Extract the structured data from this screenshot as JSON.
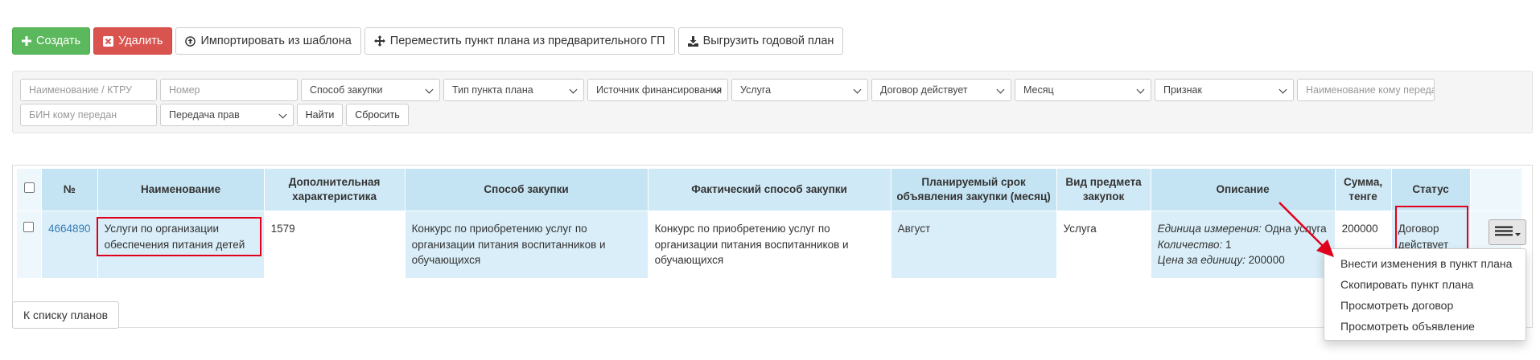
{
  "toolbar": {
    "create": "Создать",
    "delete": "Удалить",
    "import": "Импортировать из шаблона",
    "move": "Переместить пункт плана из предварительного ГП",
    "export": "Выгрузить годовой план"
  },
  "filters": {
    "name_placeholder": "Наименование / КТРУ",
    "number_placeholder": "Номер",
    "method": "Способ закупки",
    "item_type": "Тип пункта плана",
    "source": "Источник финансирования",
    "service": "Услуга",
    "contract": "Договор действует",
    "month": "Месяц",
    "sign": "Признак",
    "recipient_name_placeholder": "Наименование кому передан",
    "bin_placeholder": "БИН кому передан",
    "rights": "Передача прав",
    "find": "Найти",
    "reset": "Сбросить"
  },
  "table": {
    "headers": {
      "number": "№",
      "name": "Наименование",
      "extra": "Дополнительная характеристика",
      "method": "Способ закупки",
      "actual_method": "Фактический способ закупки",
      "planned_month_1": "Планируемый срок",
      "planned_month_2": "объявления закупки (месяц)",
      "subject_type_1": "Вид предмета",
      "subject_type_2": "закупок",
      "description": "Описание",
      "sum_1": "Сумма,",
      "sum_2": "тенге",
      "status": "Статус"
    },
    "row": {
      "number": "4664890",
      "name_1": "Услуги по организации",
      "name_2": "обеспечения питания детей",
      "extra": "1579",
      "method_1": "Конкурс по приобретению услуг по",
      "method_2": "организации питания воспитанников и",
      "method_3": "обучающихся",
      "actual_1": "Конкурс по приобретению услуг по",
      "actual_2": "организации питания воспитанников и",
      "actual_3": "обучающихся",
      "month": "Август",
      "subject_type": "Услуга",
      "unit_label": "Единица измерения:",
      "unit_value": "Одна услуга",
      "qty_label": "Количество:",
      "qty_value": "1",
      "price_label": "Цена за единицу:",
      "price_value": "200000",
      "sum": "200000",
      "status_1": "Договор",
      "status_2": "действует"
    }
  },
  "dropdown": {
    "items": [
      "Внести изменения в пункт плана",
      "Скопировать пункт плана",
      "Просмотреть договор",
      "Просмотреть объявление"
    ]
  },
  "back_button": "К списку планов",
  "colors": {
    "success": "#5cb85c",
    "danger": "#d9534f",
    "header_bg": "#d0e9f6",
    "highlight": "#e0001b",
    "link": "#337ab7"
  }
}
